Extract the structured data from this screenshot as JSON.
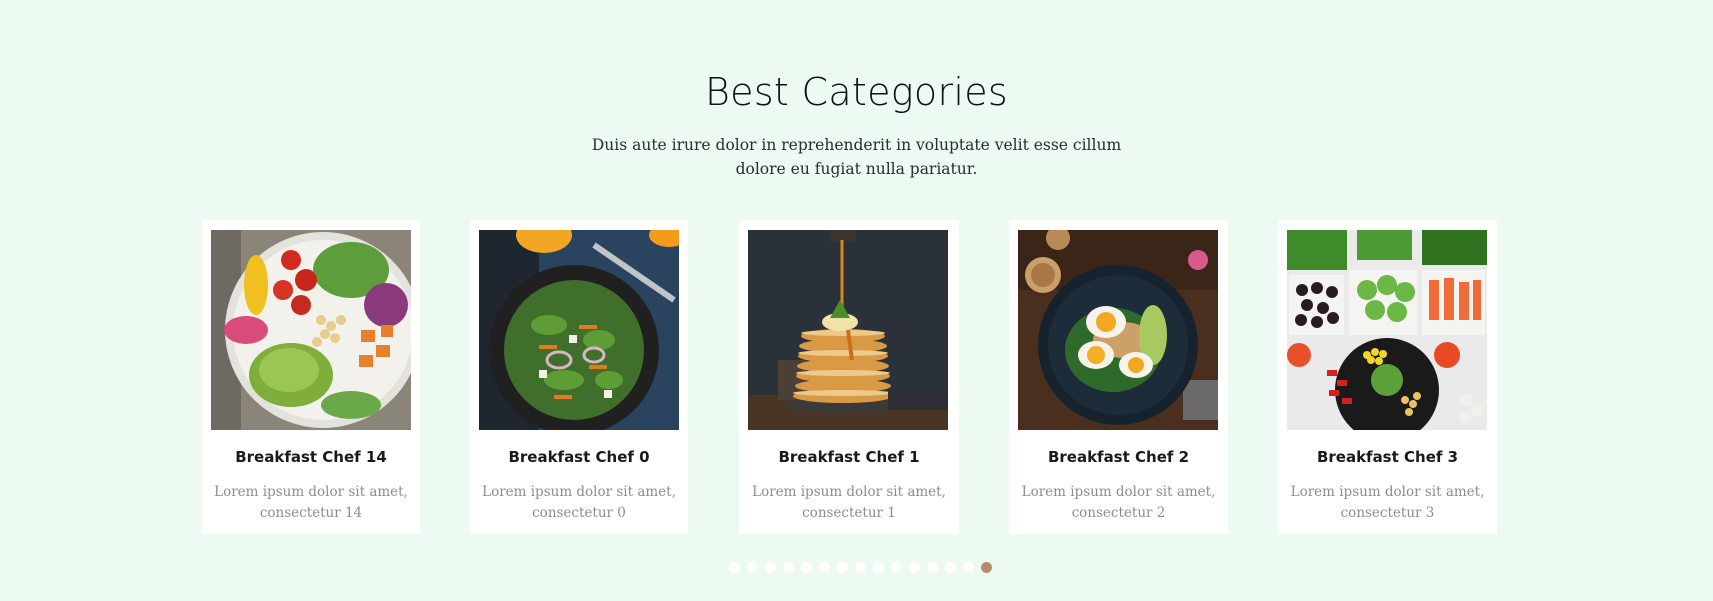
{
  "section": {
    "title": "Best Categories",
    "subtitle_line1": "Duis aute irure dolor in reprehenderit in voluptate velit esse cillum",
    "subtitle_line2": "dolore eu fugiat nulla pariatur."
  },
  "cards": [
    {
      "title": "Breakfast Chef 14",
      "desc_line1": "Lorem ipsum dolor sit amet,",
      "desc_line2": "consectetur 14",
      "image_icon": "salad-bowl-image"
    },
    {
      "title": "Breakfast Chef 0",
      "desc_line1": "Lorem ipsum dolor sit amet,",
      "desc_line2": "consectetur 0",
      "image_icon": "salad-plate-image"
    },
    {
      "title": "Breakfast Chef 1",
      "desc_line1": "Lorem ipsum dolor sit amet,",
      "desc_line2": "consectetur 1",
      "image_icon": "pancake-stack-image"
    },
    {
      "title": "Breakfast Chef 2",
      "desc_line1": "Lorem ipsum dolor sit amet,",
      "desc_line2": "consectetur 2",
      "image_icon": "egg-avocado-plate-image"
    },
    {
      "title": "Breakfast Chef 3",
      "desc_line1": "Lorem ipsum dolor sit amet,",
      "desc_line2": "consectetur 3",
      "image_icon": "vegetable-platter-image"
    }
  ],
  "pagination": {
    "total_dots": 15,
    "active_index": 14
  },
  "colors": {
    "background": "#edfaf2",
    "card": "#ffffff",
    "dot_inactive": "#ffffff",
    "dot_active": "#b98a6a"
  }
}
